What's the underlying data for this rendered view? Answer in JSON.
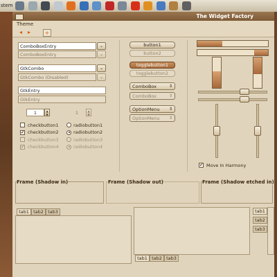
{
  "panel": {
    "label": "stem",
    "icons": [
      "screen-icon",
      "folder-icon",
      "terminal-icon",
      "mail-icon",
      "firefox-icon",
      "globe-icon",
      "document-icon",
      "pdf-icon",
      "people-icon",
      "table-icon",
      "warning-icon",
      "edit-icon",
      "package-icon",
      "camera-icon"
    ],
    "icon_colors": [
      "#6a7a8a",
      "#9aa8b0",
      "#444a52",
      "#c0c8d0",
      "#e07020",
      "#3870b8",
      "#6090c8",
      "#c02828",
      "#7a8898",
      "#d83018",
      "#e09020",
      "#4a7ac0",
      "#b08040",
      "#606060"
    ]
  },
  "window": {
    "title": "The Widget Factory",
    "menu": [
      "Theme"
    ],
    "toolbar": {
      "back": "◂",
      "forward": "▸",
      "add": "+"
    }
  },
  "entries": {
    "combo_entry": "ComboBoxEntry",
    "combo_entry_dis": "ComboBoxEntry",
    "gtk_combo": "GtkCombo",
    "gtk_combo_dis": "GtkCombo (Disabled)",
    "gtk_entry": "GtkEntry",
    "gtk_entry_dis": "GtkEntry",
    "dropdown": "⌄"
  },
  "spin": {
    "value1": "1",
    "value2": "1",
    "up": "▲",
    "down": "▼"
  },
  "checks": [
    {
      "label": "checkbutton1",
      "checked": false,
      "disabled": false
    },
    {
      "label": "checkbutton2",
      "checked": true,
      "disabled": false
    },
    {
      "label": "checkbutton3",
      "checked": false,
      "disabled": true
    },
    {
      "label": "checkbutton4",
      "checked": true,
      "disabled": true
    }
  ],
  "radios": [
    {
      "label": "radiobutton1",
      "on": false,
      "disabled": false
    },
    {
      "label": "radiobutton2",
      "on": true,
      "disabled": false
    },
    {
      "label": "radiobutton3",
      "on": false,
      "disabled": true
    },
    {
      "label": "radiobutton4",
      "on": true,
      "disabled": true
    }
  ],
  "buttons": {
    "button1": "button1",
    "button2": "button2",
    "toggle1": "togglebutton1",
    "toggle2": "togglebutton2",
    "combo1": "ComboBox",
    "combo2": "ComboBox",
    "option1": "OptionMenu",
    "option2": "OptionMenu",
    "arrow": "⇕"
  },
  "progress": {
    "h1": 0.35,
    "h2": 0.2,
    "v1": 0.55,
    "v2": 0.55
  },
  "scales": {
    "h1": 0.7,
    "h2": 0.7,
    "v1": 0.5,
    "v2": 0.5
  },
  "harmony": {
    "label": "Move In Harmony",
    "checked": true
  },
  "frames": [
    "Frame (Shadow in)",
    "Frame (Shadow out)",
    "Frame (Shadow etched in)"
  ],
  "tabs": [
    "tab1",
    "tab2",
    "tab3"
  ],
  "colors": {
    "accent": "#a86c3c",
    "background": "#e0d4bc"
  }
}
